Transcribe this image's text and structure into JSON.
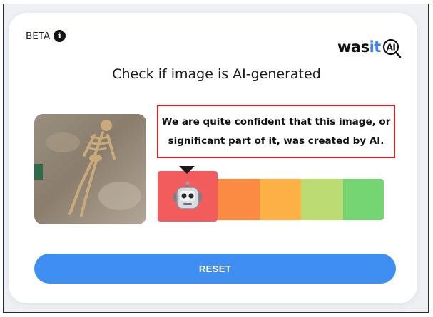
{
  "header": {
    "beta_label": "BETA",
    "info_icon": "info-circle-icon",
    "logo": {
      "text_dark": "was",
      "text_blue": "it",
      "badge": "AI"
    }
  },
  "main": {
    "headline": "Check if image is AI-generated",
    "image": {
      "subject": "skeleton-in-excavation"
    },
    "verdict": {
      "line1": "We are quite confident that this image, or",
      "line2": "significant part of it, was created by AI.",
      "border_color": "#e02020"
    },
    "meter": {
      "selected_index": 0,
      "segment_colors": [
        "#f25c5c",
        "#fb8a42",
        "#fdb046",
        "#bcdb73",
        "#76d573"
      ],
      "selected_icon": "robot-icon"
    },
    "reset_label": "RESET"
  },
  "colors": {
    "accent": "#3f8ef2",
    "brand_blue": "#3b82f6"
  }
}
